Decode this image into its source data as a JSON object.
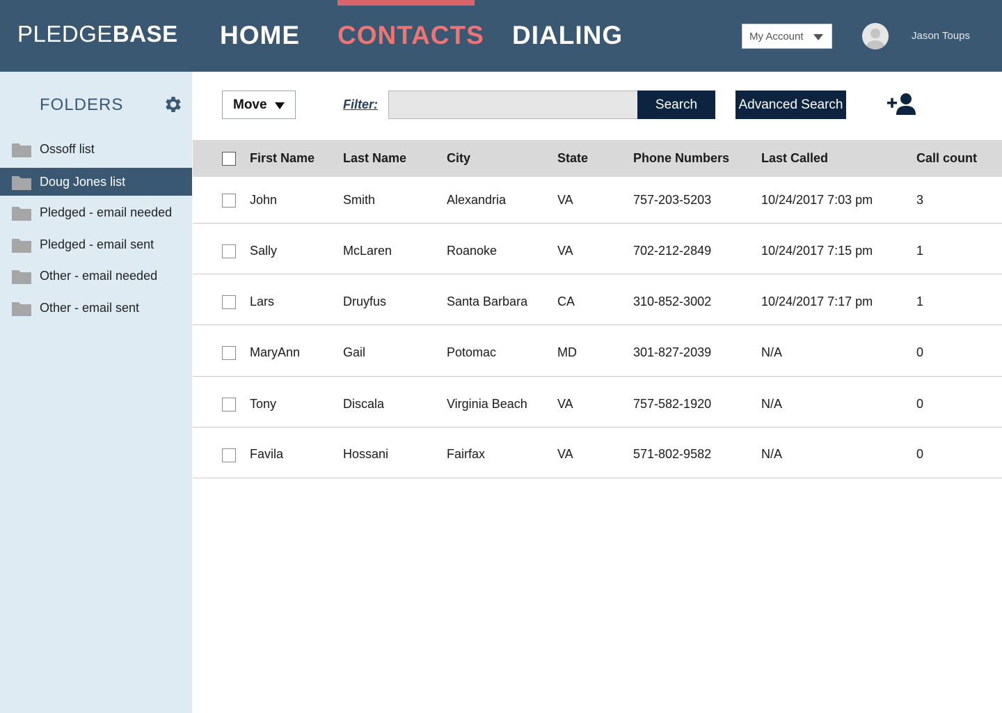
{
  "header": {
    "logo_thin": "PLEDGE",
    "logo_bold": "BASE",
    "nav": [
      {
        "label": "HOME",
        "active": false
      },
      {
        "label": "CONTACTS",
        "active": true
      },
      {
        "label": "DIALING",
        "active": false
      }
    ],
    "account_select": "My Account",
    "username": "Jason Toups",
    "avatar_icon": "user-avatar-icon"
  },
  "sidebar": {
    "title": "FOLDERS",
    "settings_icon": "gear-icon",
    "items": [
      {
        "label": "Ossoff list",
        "active": false
      },
      {
        "label": "Doug Jones list",
        "active": true
      },
      {
        "label": "Pledged - email needed",
        "active": false
      },
      {
        "label": "Pledged - email sent",
        "active": false
      },
      {
        "label": "Other - email needed",
        "active": false
      },
      {
        "label": "Other - email sent",
        "active": false
      }
    ]
  },
  "toolbar": {
    "move_label": "Move",
    "filter_label": "Filter:",
    "filter_value": "",
    "search_label": "Search",
    "advanced_search_label": "Advanced Search",
    "add_contact_icon": "add-user-icon"
  },
  "table": {
    "headers": {
      "first": "First Name",
      "last": "Last Name",
      "city": "City",
      "state": "State",
      "phone": "Phone Numbers",
      "called": "Last Called",
      "count": "Call count"
    },
    "rows": [
      {
        "first": "John",
        "last": "Smith",
        "city": "Alexandria",
        "state": "VA",
        "phone": "757-203-5203",
        "called": "10/24/2017 7:03 pm",
        "count": "3"
      },
      {
        "first": "Sally",
        "last": "McLaren",
        "city": "Roanoke",
        "state": "VA",
        "phone": "702-212-2849",
        "called": "10/24/2017 7:15 pm",
        "count": "1"
      },
      {
        "first": "Lars",
        "last": "Druyfus",
        "city": "Santa Barbara",
        "state": "CA",
        "phone": "310-852-3002",
        "called": "10/24/2017 7:17 pm",
        "count": "1"
      },
      {
        "first": "MaryAnn",
        "last": "Gail",
        "city": "Potomac",
        "state": "MD",
        "phone": "301-827-2039",
        "called": "N/A",
        "count": "0"
      },
      {
        "first": "Tony",
        "last": "Discala",
        "city": "Virginia Beach",
        "state": "VA",
        "phone": "757-582-1920",
        "called": "N/A",
        "count": "0"
      },
      {
        "first": "Favila",
        "last": "Hossani",
        "city": "Fairfax",
        "state": "VA",
        "phone": "571-802-9582",
        "called": "N/A",
        "count": "0"
      }
    ]
  },
  "colors": {
    "header_bg": "#3b5873",
    "nav_active": "#ef7474",
    "sidebar_bg": "#deebf3",
    "button_dark": "#0d2440"
  }
}
